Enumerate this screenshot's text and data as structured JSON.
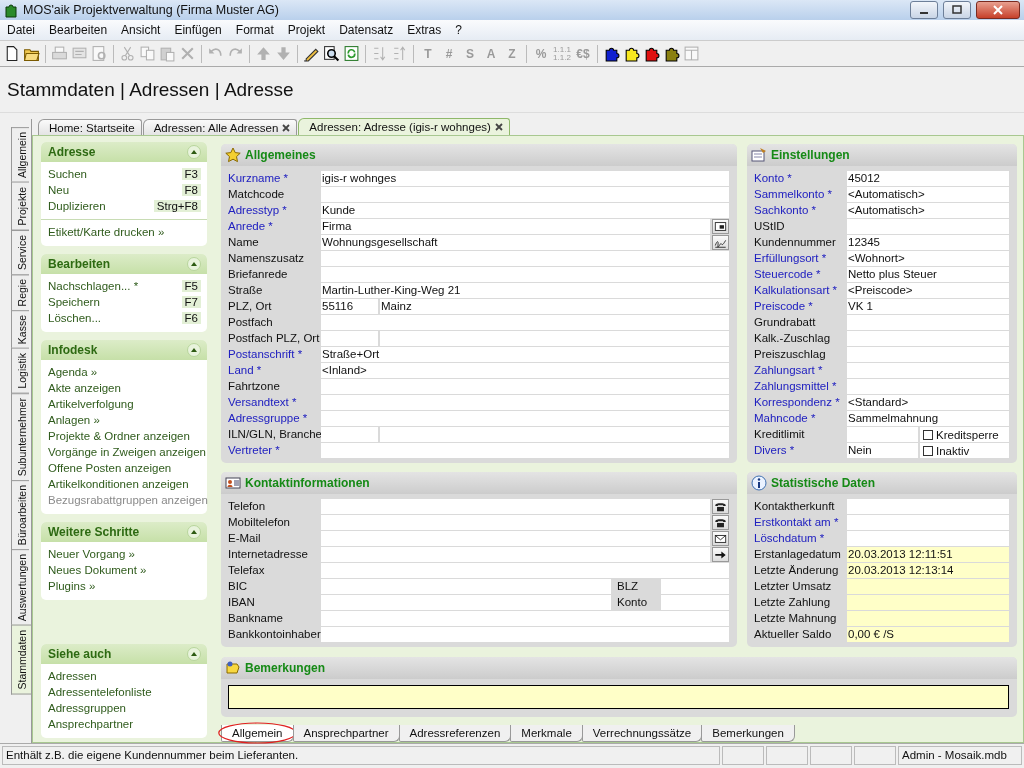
{
  "window": {
    "title": "MOS'aik Projektverwaltung (Firma Muster AG)"
  },
  "menu": [
    "Datei",
    "Bearbeiten",
    "Ansicht",
    "Einfügen",
    "Format",
    "Projekt",
    "Datensatz",
    "Extras",
    "?"
  ],
  "toolbar": [
    {
      "items": [
        {
          "kind": "icon",
          "disabled": false
        },
        {
          "kind": "icon",
          "disabled": false
        }
      ]
    },
    {
      "items": [
        {
          "kind": "icon",
          "disabled": true
        },
        {
          "kind": "icon",
          "disabled": true
        },
        {
          "kind": "icon",
          "disabled": true
        }
      ]
    },
    {
      "items": [
        {
          "kind": "icon",
          "disabled": true
        },
        {
          "kind": "icon",
          "disabled": true
        },
        {
          "kind": "icon",
          "disabled": true
        },
        {
          "kind": "icon",
          "disabled": true
        }
      ]
    },
    {
      "items": [
        {
          "kind": "icon",
          "disabled": true
        },
        {
          "kind": "icon",
          "disabled": true
        }
      ]
    },
    {
      "items": [
        {
          "kind": "icon",
          "disabled": true
        },
        {
          "kind": "icon",
          "disabled": true
        }
      ]
    },
    {
      "items": [
        {
          "kind": "icon",
          "disabled": false
        },
        {
          "kind": "icon",
          "disabled": false
        },
        {
          "kind": "icon",
          "disabled": false
        }
      ]
    },
    {
      "items": [
        {
          "kind": "icon",
          "disabled": true
        },
        {
          "kind": "icon",
          "disabled": true
        }
      ]
    },
    {
      "items": [
        {
          "kind": "text",
          "label": "T",
          "disabled": true
        },
        {
          "kind": "text",
          "label": "#",
          "disabled": true
        },
        {
          "kind": "text",
          "label": "S",
          "disabled": true
        },
        {
          "kind": "text",
          "label": "A",
          "disabled": true
        },
        {
          "kind": "text",
          "label": "Z",
          "disabled": true
        }
      ]
    },
    {
      "items": [
        {
          "kind": "text",
          "label": "%",
          "disabled": true
        },
        {
          "kind": "stack",
          "lines": [
            "1.1.1",
            "1.1.2"
          ],
          "disabled": true
        },
        {
          "kind": "text",
          "label": "€$",
          "disabled": true
        }
      ]
    },
    {
      "items": [
        {
          "kind": "icon",
          "disabled": false
        },
        {
          "kind": "icon",
          "disabled": false
        },
        {
          "kind": "icon",
          "disabled": false
        },
        {
          "kind": "icon",
          "disabled": false
        },
        {
          "kind": "icon",
          "disabled": true
        }
      ]
    }
  ],
  "heading": "Stammdaten | Adressen | Adresse",
  "side_tabs": [
    {
      "label": "Allgemein",
      "selected": false
    },
    {
      "label": "Projekte",
      "selected": false
    },
    {
      "label": "Service",
      "selected": false
    },
    {
      "label": "Regie",
      "selected": false
    },
    {
      "label": "Kasse",
      "selected": false
    },
    {
      "label": "Logistik",
      "selected": false
    },
    {
      "label": "Subunternehmer",
      "selected": false
    },
    {
      "label": "Büroarbeiten",
      "selected": false
    },
    {
      "label": "Auswertungen",
      "selected": false
    },
    {
      "label": "Stammdaten",
      "selected": true
    }
  ],
  "doc_tabs": [
    {
      "label": "Home: Startseite",
      "selected": false,
      "closable": false
    },
    {
      "label": "Adressen: Alle Adressen",
      "selected": false,
      "closable": true
    },
    {
      "label": "Adressen: Adresse (igis-r wohnges)",
      "selected": true,
      "closable": true
    }
  ],
  "sidebar": [
    {
      "title": "Adresse",
      "items": [
        {
          "label": "Suchen",
          "shortcut": "F3",
          "disabled": false,
          "separated": false
        },
        {
          "label": "Neu",
          "shortcut": "F8",
          "disabled": false,
          "separated": false
        },
        {
          "label": "Duplizieren",
          "shortcut": "Strg+F8",
          "disabled": false,
          "separated": false
        },
        {
          "label": "Etikett/Karte drucken »",
          "disabled": false,
          "separated": true
        }
      ]
    },
    {
      "title": "Bearbeiten",
      "items": [
        {
          "label": "Nachschlagen... *",
          "shortcut": "F5",
          "disabled": false,
          "separated": false
        },
        {
          "label": "Speichern",
          "shortcut": "F7",
          "disabled": false,
          "separated": false
        },
        {
          "label": "Löschen...",
          "shortcut": "F6",
          "disabled": false,
          "separated": false
        }
      ]
    },
    {
      "title": "Infodesk",
      "items": [
        {
          "label": "Agenda »",
          "disabled": false,
          "separated": false
        },
        {
          "label": "Akte anzeigen",
          "disabled": false,
          "separated": false
        },
        {
          "label": "Artikelverfolgung",
          "disabled": false,
          "separated": false
        },
        {
          "label": "Anlagen »",
          "disabled": false,
          "separated": false
        },
        {
          "label": "Projekte & Ordner anzeigen",
          "disabled": false,
          "separated": false
        },
        {
          "label": "Vorgänge in Zweigen anzeigen",
          "disabled": false,
          "separated": false
        },
        {
          "label": "Offene Posten anzeigen",
          "disabled": false,
          "separated": false
        },
        {
          "label": "Artikelkonditionen anzeigen",
          "disabled": false,
          "separated": false
        },
        {
          "label": "Bezugsrabattgruppen anzeigen",
          "disabled": true,
          "separated": false
        }
      ]
    },
    {
      "title": "Weitere Schritte",
      "items": [
        {
          "label": "Neuer Vorgang »",
          "disabled": false,
          "separated": false
        },
        {
          "label": "Neues Dokument »",
          "disabled": false,
          "separated": false
        },
        {
          "label": "Plugins »",
          "disabled": false,
          "separated": false
        }
      ]
    },
    {
      "title": "Siehe auch",
      "items": [
        {
          "label": "Adressen",
          "disabled": false,
          "separated": false
        },
        {
          "label": "Adressentelefonliste",
          "disabled": false,
          "separated": false
        },
        {
          "label": "Adressgruppen",
          "disabled": false,
          "separated": false
        },
        {
          "label": "Ansprechpartner",
          "disabled": false,
          "separated": false
        }
      ]
    }
  ],
  "allgemeines": {
    "title": "Allgemeines",
    "fields": [
      {
        "label": "Kurzname *",
        "required": true,
        "kind": "plain",
        "value": "igis-r wohnges"
      },
      {
        "label": "Matchcode",
        "required": false,
        "kind": "plain"
      },
      {
        "label": "Adresstyp *",
        "required": true,
        "kind": "plain",
        "value": "Kunde"
      },
      {
        "label": "Anrede *",
        "required": true,
        "kind": "pick",
        "value": "Firma"
      },
      {
        "label": "Name",
        "required": false,
        "kind": "sign",
        "value": "Wohnungsgesellschaft"
      },
      {
        "label": "Namenszusatz",
        "required": false,
        "kind": "plain"
      },
      {
        "label": "Briefanrede",
        "required": false,
        "kind": "plain"
      },
      {
        "label": "Straße",
        "required": false,
        "kind": "plain",
        "value": "Martin-Luther-King-Weg 21"
      },
      {
        "label": "PLZ, Ort",
        "required": false,
        "kind": "split",
        "value": "55116",
        "value_2": "Mainz"
      },
      {
        "label": "Postfach",
        "required": false,
        "kind": "plain"
      },
      {
        "label": "Postfach PLZ, Ort",
        "required": false,
        "kind": "split"
      },
      {
        "label": "Postanschrift *",
        "required": true,
        "kind": "plain",
        "value": "Straße+Ort"
      },
      {
        "label": "Land *",
        "required": true,
        "kind": "plain",
        "value": "<Inland>"
      },
      {
        "label": "Fahrtzone",
        "required": false,
        "kind": "plain"
      },
      {
        "label": "Versandtext *",
        "required": true,
        "kind": "plain"
      },
      {
        "label": "Adressgruppe *",
        "required": true,
        "kind": "plain"
      },
      {
        "label": "ILN/GLN, Branche",
        "required": false,
        "kind": "split"
      },
      {
        "label": "Vertreter *",
        "required": true,
        "kind": "plain"
      }
    ]
  },
  "einstellungen": {
    "title": "Einstellungen",
    "fields": [
      {
        "label": "Konto *",
        "required": true,
        "kind": "plain",
        "value": "45012"
      },
      {
        "label": "Sammelkonto *",
        "required": true,
        "kind": "plain",
        "value": "<Automatisch>"
      },
      {
        "label": "Sachkonto *",
        "required": true,
        "kind": "plain",
        "value": "<Automatisch>"
      },
      {
        "label": "UStID",
        "required": false,
        "kind": "plain"
      },
      {
        "label": "Kundennummer",
        "required": false,
        "kind": "plain",
        "value": "12345"
      },
      {
        "label": "Erfüllungsort *",
        "required": true,
        "kind": "plain",
        "value": "<Wohnort>"
      },
      {
        "label": "Steuercode *",
        "required": true,
        "kind": "plain",
        "value": "Netto plus Steuer"
      },
      {
        "label": "Kalkulationsart *",
        "required": true,
        "kind": "plain",
        "value": "<Preiscode>"
      },
      {
        "label": "Preiscode *",
        "required": true,
        "kind": "plain",
        "value": "VK 1"
      },
      {
        "label": "Grundrabatt",
        "required": false,
        "kind": "plain"
      },
      {
        "label": "Kalk.-Zuschlag",
        "required": false,
        "kind": "plain"
      },
      {
        "label": "Preiszuschlag",
        "required": false,
        "kind": "plain"
      },
      {
        "label": "Zahlungsart *",
        "required": true,
        "kind": "plain"
      },
      {
        "label": "Zahlungsmittel *",
        "required": true,
        "kind": "plain"
      },
      {
        "label": "Korrespondenz *",
        "required": true,
        "kind": "plain",
        "value": "<Standard>"
      },
      {
        "label": "Mahncode *",
        "required": true,
        "kind": "plain",
        "value": "Sammelmahnung"
      },
      {
        "label": "Kreditlimit",
        "required": false,
        "kind": "check",
        "check_label": "Kreditsperre",
        "checked": false
      },
      {
        "label": "Divers *",
        "required": true,
        "kind": "check",
        "value": "Nein",
        "check_label": "Inaktiv",
        "checked": false
      }
    ]
  },
  "kontakt": {
    "title": "Kontaktinformationen",
    "fields": [
      {
        "label": "Telefon",
        "required": false,
        "kind": "dial"
      },
      {
        "label": "Mobiltelefon",
        "required": false,
        "kind": "dial"
      },
      {
        "label": "E-Mail",
        "required": false,
        "kind": "mail"
      },
      {
        "label": "Internetadresse",
        "required": false,
        "kind": "link"
      },
      {
        "label": "Telefax",
        "required": false,
        "kind": "plain"
      },
      {
        "label": "BIC",
        "required": false,
        "kind": "pair",
        "label_2": "BLZ"
      },
      {
        "label": "IBAN",
        "required": false,
        "kind": "pair",
        "label_2": "Konto"
      },
      {
        "label": "Bankname",
        "required": false,
        "kind": "plain"
      },
      {
        "label": "Bankkontoinhaber",
        "required": false,
        "kind": "plain"
      }
    ]
  },
  "statistik": {
    "title": "Statistische Daten",
    "fields": [
      {
        "label": "Kontaktherkunft",
        "required": false,
        "readonly": false,
        "kind": "plain"
      },
      {
        "label": "Erstkontakt am *",
        "required": true,
        "readonly": false,
        "kind": "plain"
      },
      {
        "label": "Löschdatum *",
        "required": true,
        "readonly": false,
        "kind": "plain"
      },
      {
        "label": "Erstanlagedatum",
        "required": false,
        "readonly": true,
        "kind": "plain",
        "value": "20.03.2013 12:11:51"
      },
      {
        "label": "Letzte Änderung",
        "required": false,
        "readonly": true,
        "kind": "plain",
        "value": "20.03.2013 12:13:14"
      },
      {
        "label": "Letzter Umsatz",
        "required": false,
        "readonly": true,
        "kind": "plain"
      },
      {
        "label": "Letzte Zahlung",
        "required": false,
        "readonly": true,
        "kind": "plain"
      },
      {
        "label": "Letzte Mahnung",
        "required": false,
        "readonly": true,
        "kind": "plain"
      },
      {
        "label": "Aktueller Saldo",
        "required": false,
        "readonly": true,
        "kind": "plain",
        "value": "0,00 € /S"
      }
    ]
  },
  "bemerkungen": {
    "title": "Bemerkungen"
  },
  "bottom_tabs": [
    {
      "label": "Allgemein",
      "selected": true,
      "circled": true
    },
    {
      "label": "Ansprechpartner",
      "selected": false,
      "circled": false
    },
    {
      "label": "Adressreferenzen",
      "selected": false,
      "circled": false
    },
    {
      "label": "Merkmale",
      "selected": false,
      "circled": false
    },
    {
      "label": "Verrechnungssätze",
      "selected": false,
      "circled": false
    },
    {
      "label": "Bemerkungen",
      "selected": false,
      "circled": false
    }
  ],
  "status_bar": {
    "message": "Enthält z.B. die eigene Kundennummer beim Lieferanten.",
    "account": "Admin - Mosaik.mdb"
  }
}
